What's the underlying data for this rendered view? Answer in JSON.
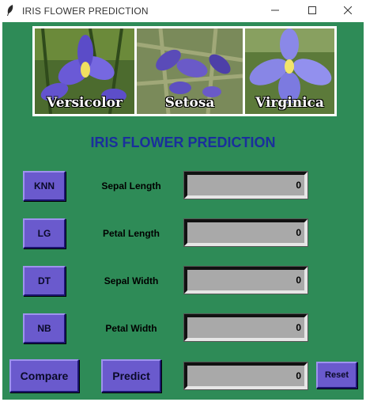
{
  "window": {
    "title": "IRIS FLOWER PREDICTION",
    "controls": {
      "minimize": "—",
      "maximize": "☐",
      "close": "✕"
    }
  },
  "banner": {
    "panels": [
      {
        "label": "Versicolor"
      },
      {
        "label": "Setosa"
      },
      {
        "label": "Virginica"
      }
    ]
  },
  "heading": "IRIS FLOWER PREDICTION",
  "algorithms": {
    "knn": "KNN",
    "lg": "LG",
    "dt": "DT",
    "nb": "NB"
  },
  "inputs": {
    "sepal_length": {
      "label": "Sepal Length",
      "value": "0"
    },
    "petal_length": {
      "label": "Petal Length",
      "value": "0"
    },
    "sepal_width": {
      "label": "Sepal Width",
      "value": "0"
    },
    "petal_width": {
      "label": "Petal Width",
      "value": "0"
    }
  },
  "actions": {
    "compare": "Compare",
    "predict": "Predict",
    "reset": "Reset"
  },
  "result": {
    "value": "0"
  },
  "colors": {
    "background": "#2e8b57",
    "button": "#6a5acd",
    "heading": "#1a2f9c",
    "field": "#a9a9a9"
  }
}
